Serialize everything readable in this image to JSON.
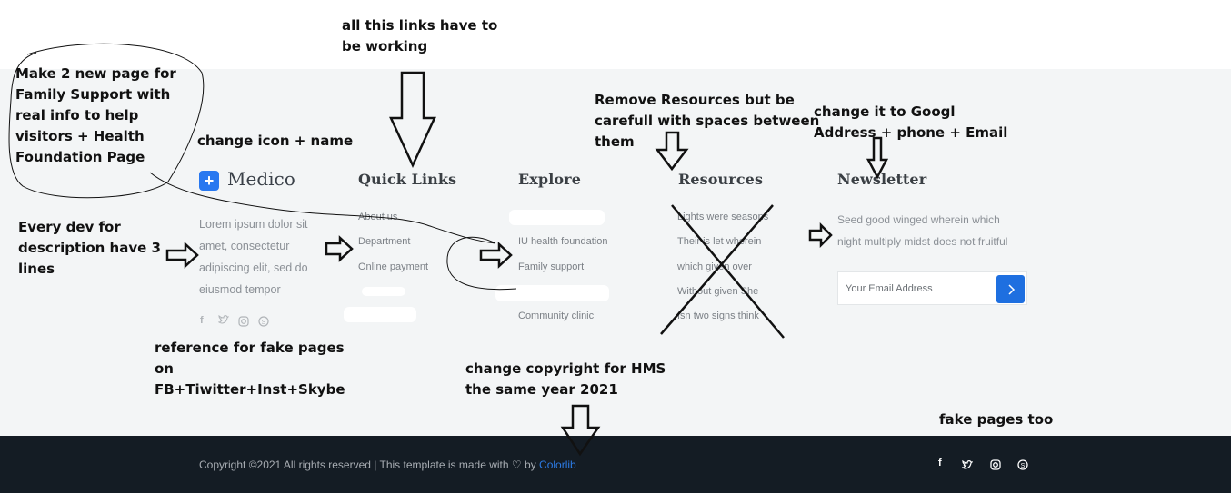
{
  "footer": {
    "logo": {
      "icon": "plus-icon",
      "name": "Medico"
    },
    "description": "Lorem ipsum dolor sit amet, consectetur adipiscing elit, sed do eiusmod tempor",
    "description_lines": [
      "Lorem ipsum dolor sit",
      "amet, consectetur",
      "adipiscing elit, sed do",
      "eiusmod tempor"
    ],
    "columns": {
      "quick_links": {
        "title": "Quick Links",
        "links": [
          "About us",
          "Department",
          "Online payment"
        ]
      },
      "explore": {
        "title": "Explore",
        "links": [
          "IU health foundation",
          "Family support",
          "Community clinic"
        ]
      },
      "resources": {
        "title": "Resources",
        "links": [
          "Lights were seasons",
          "Their is let wherein",
          "which given over",
          "Without given She",
          "Isn two signs think"
        ]
      },
      "newsletter": {
        "title": "Newsletter",
        "text_lines": [
          "Seed good winged wherein which",
          "night multiply midst does not fruitful"
        ],
        "placeholder": "Your Email Address",
        "button_icon": "chevron-right-icon"
      }
    },
    "social": [
      "facebook-icon",
      "twitter-icon",
      "instagram-icon",
      "skype-icon"
    ],
    "copyright": {
      "prefix": "Copyright ©2021 All rights reserved | This template is made with",
      "heart": "♡",
      "by": "by",
      "link": "Colorlib"
    }
  },
  "annotations": {
    "family_support": [
      "Make 2 new page for",
      "Family Support with",
      "real info to help",
      "visitors + Health",
      "Foundation Page"
    ],
    "links_working": [
      "all this links have to",
      "be working"
    ],
    "change_icon": "change icon + name",
    "remove_resources": [
      "Remove Resources but be",
      "carefull with spaces between",
      "them"
    ],
    "newsletter_change": [
      "change it to Googl",
      "Address + phone + Email"
    ],
    "description_lines": [
      "Every dev for",
      "description have 3",
      "lines"
    ],
    "social_reference": [
      "reference for fake pages",
      "on",
      "FB+Tiwitter+Inst+Skybe"
    ],
    "copyright_change": [
      "change copyright for HMS",
      "the same year 2021"
    ],
    "fake_pages": "fake pages too"
  },
  "colors": {
    "accent": "#1e6fe0",
    "footer_bg": "#f3f5f6",
    "bottom_bg": "#141c24",
    "link_blue": "#2c7be5"
  }
}
